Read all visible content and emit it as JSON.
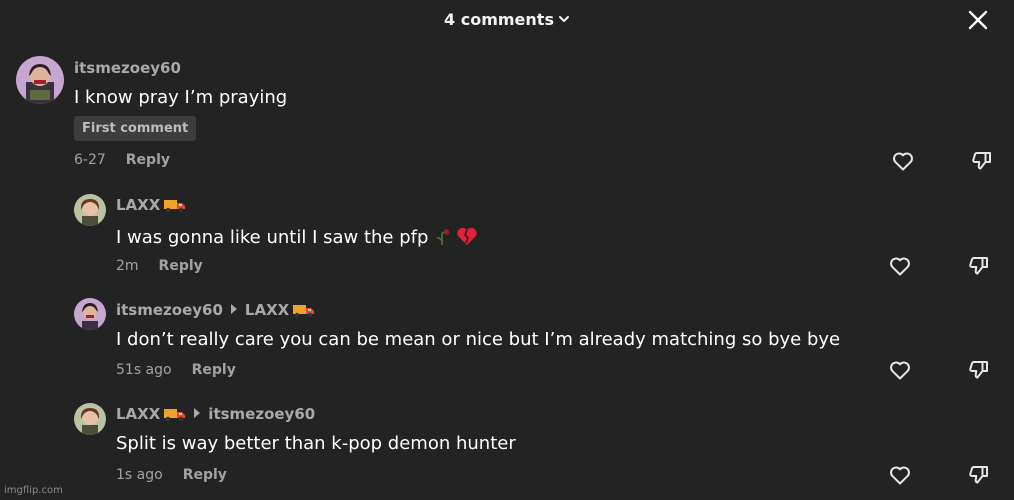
{
  "header": {
    "title": "4 comments",
    "icons": {
      "dropdown": "chevron-down-icon",
      "close": "close-icon"
    }
  },
  "comments": [
    {
      "username": "itsmezoey60",
      "text": "I know pray I’m praying",
      "badge": "First comment",
      "time": "6-27",
      "reply_label": "Reply"
    },
    {
      "username": "LAXX",
      "text": "I was gonna like until I saw the pfp",
      "time": "2m",
      "reply_label": "Reply"
    },
    {
      "username": "itsmezoey60",
      "reply_to": "LAXX",
      "text": "I don’t really care you can be mean or nice but I’m already matching so bye bye",
      "time": "51s ago",
      "reply_label": "Reply"
    },
    {
      "username": "LAXX",
      "reply_to": "itsmezoey60",
      "text": "Split is way better than k-pop demon hunter",
      "time": "1s ago",
      "reply_label": "Reply"
    }
  ],
  "watermark": "imgflip.com",
  "colors": {
    "background": "#232323",
    "username": "#a9a9a9",
    "meta": "#a2a2a2",
    "badge_bg": "#3d3d3d",
    "text": "#ffffff"
  }
}
